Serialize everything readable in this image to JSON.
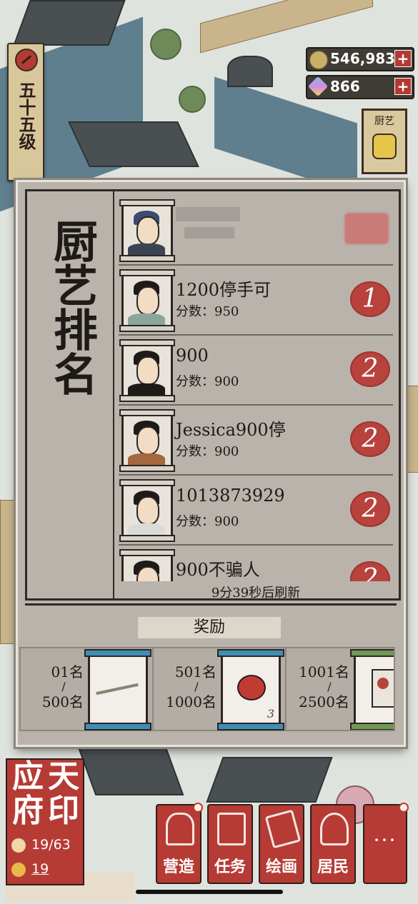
{
  "hud": {
    "level_label": "五十五级",
    "coins": "546,983",
    "gems": "866",
    "plus": "+",
    "craft_badge_label": "厨艺"
  },
  "ranking": {
    "title": "厨艺排名",
    "entries": [
      {
        "name": "",
        "score_label": "",
        "rank": ""
      },
      {
        "name": "1200停手可",
        "score_label": "分数：950",
        "rank": "1"
      },
      {
        "name": "900",
        "score_label": "分数：900",
        "rank": "2"
      },
      {
        "name": "Jessica900停",
        "score_label": "分数：900",
        "rank": "2"
      },
      {
        "name": "1013873929",
        "score_label": "分数：900",
        "rank": "2"
      },
      {
        "name": "900不骗人",
        "score_label": "",
        "rank": "2"
      }
    ],
    "refresh_text": "9分39秒后刷新"
  },
  "rewards": {
    "title": "奖励",
    "cards": [
      {
        "from": "01名",
        "to": "500名",
        "quantity": ""
      },
      {
        "from": "501名",
        "to": "1000名",
        "quantity": "3"
      },
      {
        "from": "1001名",
        "to": "2500名",
        "quantity": ""
      }
    ]
  },
  "city": {
    "name_chars": [
      "应",
      "天",
      "府",
      "印"
    ],
    "population": "19/63",
    "happiness": "19"
  },
  "menu": {
    "build": "营造",
    "tasks": "任务",
    "painting": "绘画",
    "residents": "居民",
    "more": "···"
  },
  "colors": {
    "seal_red": "#b8423c",
    "panel_bg": "#b9b3ab",
    "ink": "#1e1a18"
  }
}
